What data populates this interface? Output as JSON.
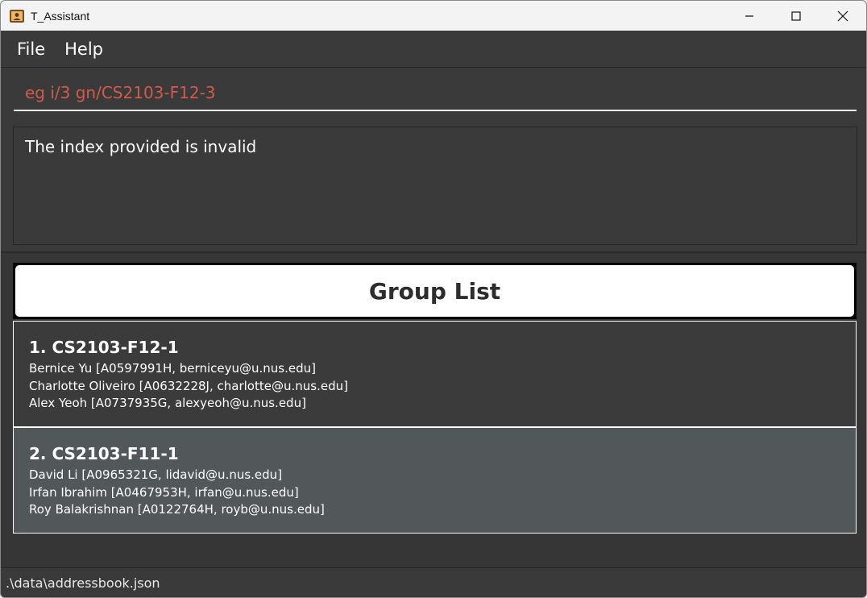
{
  "window": {
    "title": "T_Assistant"
  },
  "menu": {
    "items": [
      {
        "label": "File"
      },
      {
        "label": "Help"
      }
    ]
  },
  "command": {
    "value": "eg i/3 gn/CS2103-F12-3"
  },
  "result": {
    "text": "The index provided is invalid"
  },
  "group_list": {
    "header": "Group List",
    "groups": [
      {
        "title": "1. CS2103-F12-1",
        "members": [
          "Bernice Yu [A0597991H, berniceyu@u.nus.edu]",
          "Charlotte Oliveiro [A0632228J, charlotte@u.nus.edu]",
          "Alex Yeoh [A0737935G, alexyeoh@u.nus.edu]"
        ]
      },
      {
        "title": "2. CS2103-F11-1",
        "members": [
          "David Li [A0965321G, lidavid@u.nus.edu]",
          "Irfan Ibrahim [A0467953H, irfan@u.nus.edu]",
          "Roy Balakrishnan [A0122764H, royb@u.nus.edu]"
        ]
      }
    ]
  },
  "status": {
    "path": ".\\data\\addressbook.json"
  },
  "colors": {
    "background": "#2d2d2d",
    "panel": "#3a3a3a",
    "command_text": "#d05a4c",
    "card_odd": "#3b3b3b",
    "card_even": "#525759"
  }
}
